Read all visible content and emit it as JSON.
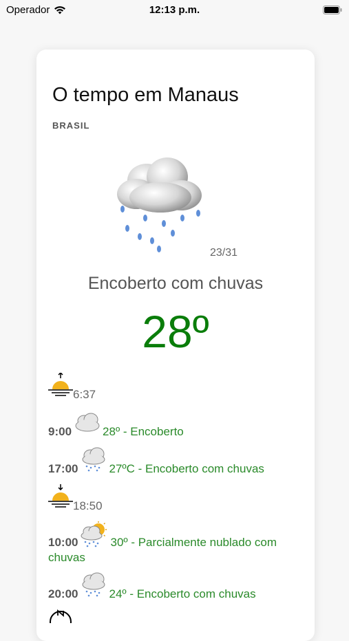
{
  "status_bar": {
    "carrier": "Operador",
    "time": "12:13 p.m."
  },
  "weather": {
    "title": "O tempo em Manaus",
    "country": "BRASIL",
    "minmax": "23/31",
    "condition": "Encoberto com chuvas",
    "temperature": "28º",
    "main_icon": "cloud-rain-icon",
    "sunrise": "6:37",
    "sunset": "18:50",
    "forecast_day1": [
      {
        "hour": "9:00",
        "text": "28º - Encoberto",
        "icon": "cloud-icon"
      },
      {
        "hour": "17:00",
        "text": "27ºC - Encoberto com chuvas",
        "icon": "cloud-rain-icon"
      }
    ],
    "forecast_day2": [
      {
        "hour": "10:00",
        "text": "30º - Parcialmente nublado com",
        "text2": "chuvas",
        "icon": "sun-cloud-rain-icon"
      },
      {
        "hour": "20:00",
        "text": "24º - Encoberto com chuvas",
        "icon": "cloud-rain-icon"
      }
    ],
    "colors": {
      "temp": "#0a7d0a",
      "forecast": "#2a8a2a"
    }
  }
}
